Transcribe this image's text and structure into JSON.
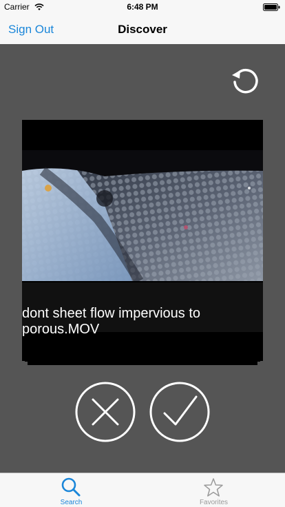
{
  "status_bar": {
    "carrier": "Carrier",
    "time": "6:48 PM"
  },
  "nav": {
    "left_label": "Sign Out",
    "title": "Discover"
  },
  "card": {
    "caption": "dont sheet flow impervious to porous.MOV"
  },
  "tabs": [
    {
      "label": "Search",
      "icon": "search-icon",
      "active": true
    },
    {
      "label": "Favorites",
      "icon": "star-icon",
      "active": false
    }
  ],
  "colors": {
    "accent": "#1a86d9",
    "background": "#555555",
    "bar": "#f7f7f7",
    "inactive": "#9a9a9a"
  }
}
